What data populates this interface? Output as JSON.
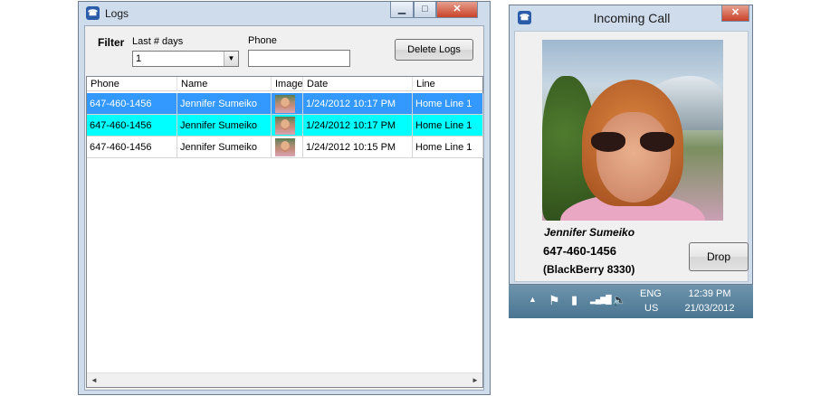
{
  "logs_window": {
    "title": "Logs",
    "app_icon": "phone-app-icon",
    "controls": {
      "minimize": "▁",
      "maximize": "□",
      "close": "✕"
    },
    "filter": {
      "heading": "Filter",
      "last_days_label": "Last # days",
      "last_days_value": "1",
      "phone_label": "Phone",
      "phone_value": ""
    },
    "delete_button": "Delete Logs",
    "grid": {
      "columns": [
        "Phone",
        "Name",
        "Image",
        "Date",
        "Line"
      ],
      "rows": [
        {
          "phone": "647-460-1456",
          "name": "Jennifer Sumeiko",
          "date": "1/24/2012 10:17 PM",
          "line": "Home Line 1",
          "state": "selected"
        },
        {
          "phone": "647-460-1456",
          "name": "Jennifer Sumeiko",
          "date": "1/24/2012 10:17 PM",
          "line": "Home Line 1",
          "state": "highlighted"
        },
        {
          "phone": "647-460-1456",
          "name": "Jennifer Sumeiko",
          "date": "1/24/2012 10:15 PM",
          "line": "Home Line 1",
          "state": "normal"
        }
      ]
    },
    "scroll_left": "◄",
    "scroll_right": "►"
  },
  "call_window": {
    "title": "Incoming Call",
    "close": "✕",
    "caller_name": "Jennifer Sumeiko",
    "caller_number": "647-460-1456",
    "caller_device": "(BlackBerry 8330)",
    "drop_button": "Drop"
  },
  "taskbar": {
    "show_hidden": "▲",
    "flag": "⚑",
    "battery": "▮",
    "signal": "▂▄▆█",
    "volume": "🔈",
    "lang_top": "ENG",
    "lang_bottom": "US",
    "time": "12:39 PM",
    "date": "21/03/2012"
  },
  "colors": {
    "selection": "#3399ff",
    "highlight": "#00ffff",
    "window_frame": "#cfdcec",
    "taskbar": "#5a84a0"
  }
}
